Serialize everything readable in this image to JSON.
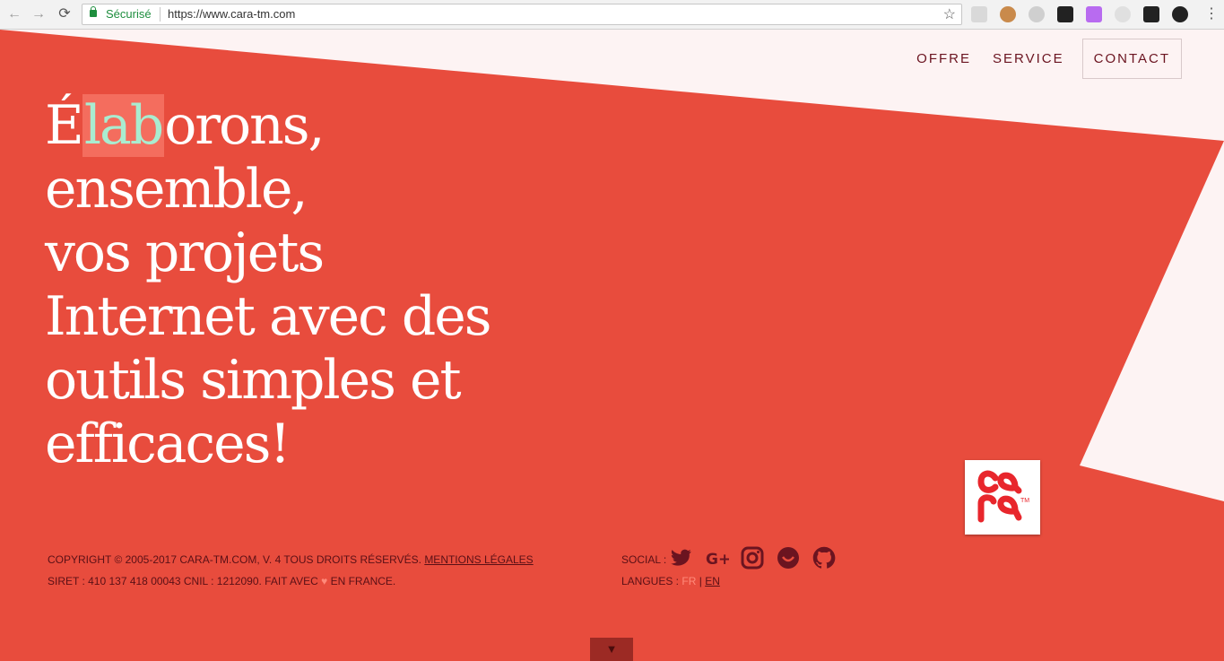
{
  "browser": {
    "secure_label": "Sécurisé",
    "url": "https://www.cara-tm.com",
    "back_icon": "←",
    "forward_icon": "→",
    "reload_icon": "⟳",
    "star_icon": "☆",
    "menu_icon": "⋮"
  },
  "nav": {
    "offre": "OFFRE",
    "service": "SERVICE",
    "contact": "CONTACT"
  },
  "hero": {
    "line1_pre": "É",
    "line1_hl": "lab",
    "line1_post": "orons,",
    "line2": "ensemble,",
    "line3": "vos projets",
    "line4": "Internet avec des",
    "line5": "outils simples et",
    "line6": "efficaces!"
  },
  "logo": {
    "tm": "TM"
  },
  "footer": {
    "copyright": "COPYRIGHT © 2005-2017 CARA-TM.COM, V. 4 TOUS DROITS RÉSERVÉS.",
    "legal_link": "MENTIONS LÉGALES",
    "siret_pre": "SIRET : 410 137 418 00043 CNIL : 1212090. FAIT AVEC",
    "heart": "♥",
    "siret_post": "EN FRANCE."
  },
  "social": {
    "label": "SOCIAL :",
    "langues_label": "LANGUES :",
    "fr": "FR",
    "separator": "|",
    "en": "EN"
  },
  "scroll": {
    "arrow": "▼"
  },
  "colors": {
    "accent": "#e84c3d",
    "light": "#fdf3f3",
    "highlight_bg": "#f46d5e",
    "highlight_text": "#a9ecd0",
    "dark": "#6b1420"
  }
}
